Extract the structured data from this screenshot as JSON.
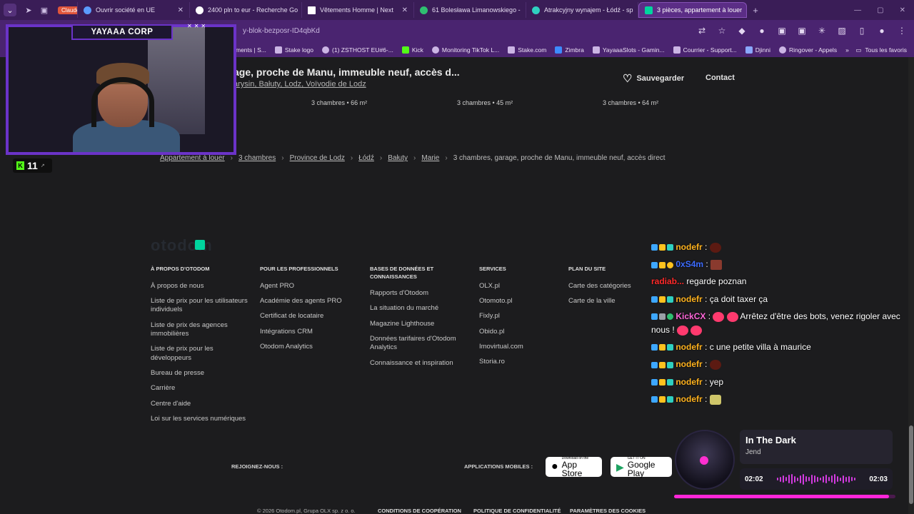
{
  "tabs": [
    {
      "label": "Claude",
      "badge": true,
      "color": "#e0553b"
    },
    {
      "label": "Ouvrir société en UE",
      "color": "#5b9bff"
    },
    {
      "label": "2400 pln to eur - Recherche Go",
      "color": "#ffffff"
    },
    {
      "label": "Vêtements Homme | Next",
      "color": "#ffffff"
    },
    {
      "label": "61 Bolesława Limanowskiego -",
      "color": "#2fbf71"
    },
    {
      "label": "Atrakcyjny wynajem - Łódź - sp",
      "color": "#2fd0c0"
    },
    {
      "label": "3 pièces, appartement à louer",
      "color": "#00d49e",
      "active": true
    }
  ],
  "address": {
    "url": "y-blok-bezposr-ID4qbKd"
  },
  "bookmarks": [
    "ments | S...",
    "Stake logo",
    "(1) ZSTHOST EU#6-...",
    "Kick",
    "Monitoring TikTok L...",
    "Stake.com",
    "Zimbra",
    "YayaaaSlots - Gamin...",
    "Courrier - Support...",
    "Djinni",
    "Ringover - Appels"
  ],
  "bookmarks_all": "Tous les favoris",
  "cam": {
    "title": "YAYAAA CORP",
    "viewers": "11"
  },
  "listing": {
    "title": "age, proche de Manu, immeuble neuf, accès d...",
    "subtitle": "arysin, Bałuty, Lodz, Voïvodie de Lodz",
    "save_label": "Sauvegarder",
    "contact_label": "Contact",
    "rooms": [
      "3 chambres • 66 m²",
      "3 chambres • 45 m²",
      "3 chambres • 64 m²"
    ]
  },
  "breadcrumb": [
    "Appartement à louer",
    "3 chambres",
    "Province de Lodz",
    "Łódź",
    "Bałuty",
    "Marie",
    "3 chambres, garage, proche de Manu, immeuble neuf, accès direct"
  ],
  "footer": {
    "logo": "otodom",
    "col1": {
      "title": "À PROPOS D'OTODOM",
      "items": [
        "À propos de nous",
        "Liste de prix pour les utilisateurs individuels",
        "Liste de prix des agences immobilières",
        "Liste de prix pour les développeurs",
        "Bureau de presse",
        "Carrière",
        "Centre d'aide",
        "Loi sur les services numériques"
      ]
    },
    "col2": {
      "title": "POUR LES PROFESSIONNELS",
      "items": [
        "Agent PRO",
        "Académie des agents PRO",
        "Certificat de locataire",
        "Intégrations CRM",
        "Otodom Analytics"
      ]
    },
    "col3": {
      "title": "BASES DE DONNÉES ET CONNAISSANCES",
      "items": [
        "Rapports d'Otodom",
        "La situation du marché",
        "Magazine Lighthouse",
        "Données tarifaires d'Otodom Analytics",
        "Connaissance et inspiration"
      ]
    },
    "col4": {
      "title": "SERVICES",
      "items": [
        "OLX.pl",
        "Otomoto.pl",
        "Fixly.pl",
        "Obido.pl",
        "Imovirtual.com",
        "Storia.ro"
      ]
    },
    "col5": {
      "title": "PLAN DU SITE",
      "items": [
        "Carte des catégories",
        "Carte de la ville"
      ]
    },
    "rejoignez": "REJOIGNEZ-NOUS :",
    "apps_label": "APPLICATIONS MOBILES :",
    "appstore": {
      "small": "Download on the",
      "big": "App Store"
    },
    "googleplay": {
      "small": "GET IT ON",
      "big": "Google Play"
    },
    "copyright": "© 2026 Otodom.pl, Grupa OLX sp. z o. o.",
    "legal": [
      "CONDITIONS DE COOPÉRATION",
      "POLITIQUE DE CONFIDENTIALITÉ",
      "PARAMÈTRES DES COOKIES"
    ]
  },
  "chat": [
    {
      "user": "nodefr",
      "color": "#ffb21e",
      "text": ""
    },
    {
      "user": "0xS4m",
      "color": "#3d6cff",
      "text": ""
    },
    {
      "user": "radiab...",
      "color": "#ff2a2a",
      "text": "regarde poznan"
    },
    {
      "user": "nodefr",
      "color": "#ffb21e",
      "text": "ça doit taxer ça"
    },
    {
      "user": "KickCX",
      "color": "#ff66d9",
      "text": "Arrêtez d'être des bots, venez rigoler avec nous !"
    },
    {
      "user": "nodefr",
      "color": "#ffb21e",
      "text": "c une petite villa à maurice"
    },
    {
      "user": "nodefr",
      "color": "#ffb21e",
      "text": ""
    },
    {
      "user": "nodefr",
      "color": "#ffb21e",
      "text": "yep"
    },
    {
      "user": "nodefr",
      "color": "#ffb21e",
      "text": ""
    }
  ],
  "player": {
    "title": "In The Dark",
    "artist": "Jend",
    "elapsed": "02:02",
    "total": "02:03",
    "progress": 0.97
  }
}
